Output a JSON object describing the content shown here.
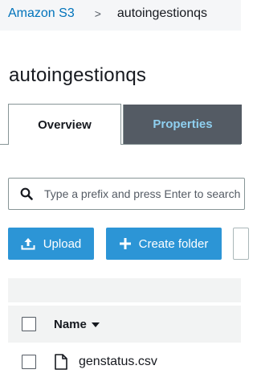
{
  "breadcrumb": {
    "root": "Amazon S3",
    "separator": ">",
    "current": "autoingestionqs"
  },
  "page": {
    "title": "autoingestionqs"
  },
  "tabs": [
    {
      "label": "Overview",
      "active": true
    },
    {
      "label": "Properties",
      "active": false
    }
  ],
  "search": {
    "placeholder": "Type a prefix and press Enter to search",
    "value": ""
  },
  "toolbar": {
    "upload_label": "Upload",
    "create_folder_label": "Create folder"
  },
  "table": {
    "columns": [
      {
        "label": "Name",
        "sort": "descending"
      }
    ],
    "rows": [
      {
        "name": "genstatus.csv",
        "type": "file",
        "icon": "file-icon"
      }
    ]
  },
  "colors": {
    "link": "#0073bb",
    "primary_button": "#2c95d6",
    "inactive_tab_bg": "#545b64",
    "inactive_tab_text": "#8fd0f0"
  }
}
